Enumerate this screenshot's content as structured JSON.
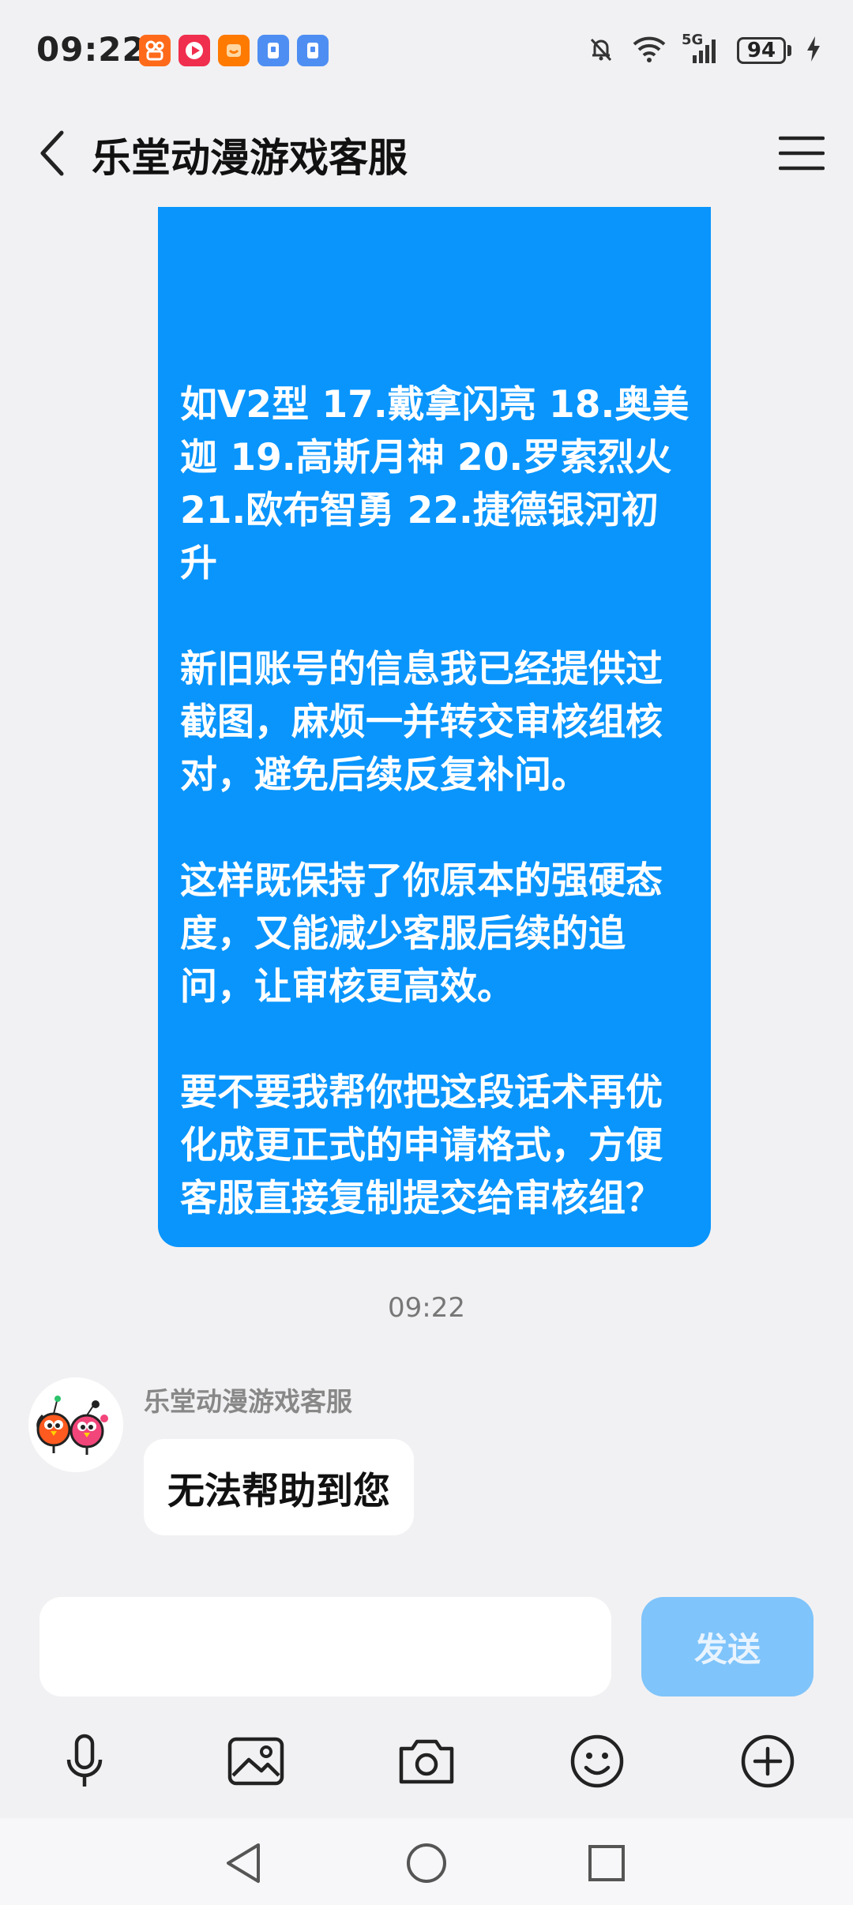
{
  "status_bar": {
    "time": "09:22",
    "battery": "94",
    "network": "5G",
    "icons": [
      "kuaishou-app-icon",
      "video-app-icon",
      "taobao-app-icon",
      "security-app-icon",
      "security-app-icon-2",
      "mute-bell-icon",
      "wifi-icon",
      "signal-icon",
      "battery-icon",
      "charging-icon"
    ]
  },
  "header": {
    "title": "乐堂动漫游戏客服",
    "icons": [
      "back-arrow-icon",
      "hamburger-menu-icon"
    ]
  },
  "chat": {
    "outgoing_message": "如V2型 17.戴拿闪亮 18.奥美迦 19.高斯月神 20.罗索烈火 21.欧布智勇 22.捷德银河初升\n\n新旧账号的信息我已经提供过截图，麻烦一并转交审核组核对，避免后续反复补问。\n\n这样既保持了你原本的强硬态度，又能减少客服后续的追问，让审核更高效。\n\n要不要我帮你把这段话术再优化成更正式的申请格式，方便客服直接复制提交给审核组？",
    "timestamp": "09:22",
    "incoming": {
      "sender": "乐堂动漫游戏客服",
      "message": "无法帮助到您"
    },
    "colors": {
      "outgoing_bubble": "#0995fc",
      "incoming_bubble": "#ffffff",
      "background": "#f1f1f3"
    }
  },
  "input_area": {
    "value": "",
    "send_label": "发送",
    "tools": [
      "microphone-icon",
      "image-icon",
      "camera-icon",
      "emoji-icon",
      "plus-icon"
    ]
  },
  "nav_bar": {
    "buttons": [
      "nav-back-icon",
      "nav-home-icon",
      "nav-recents-icon"
    ]
  }
}
